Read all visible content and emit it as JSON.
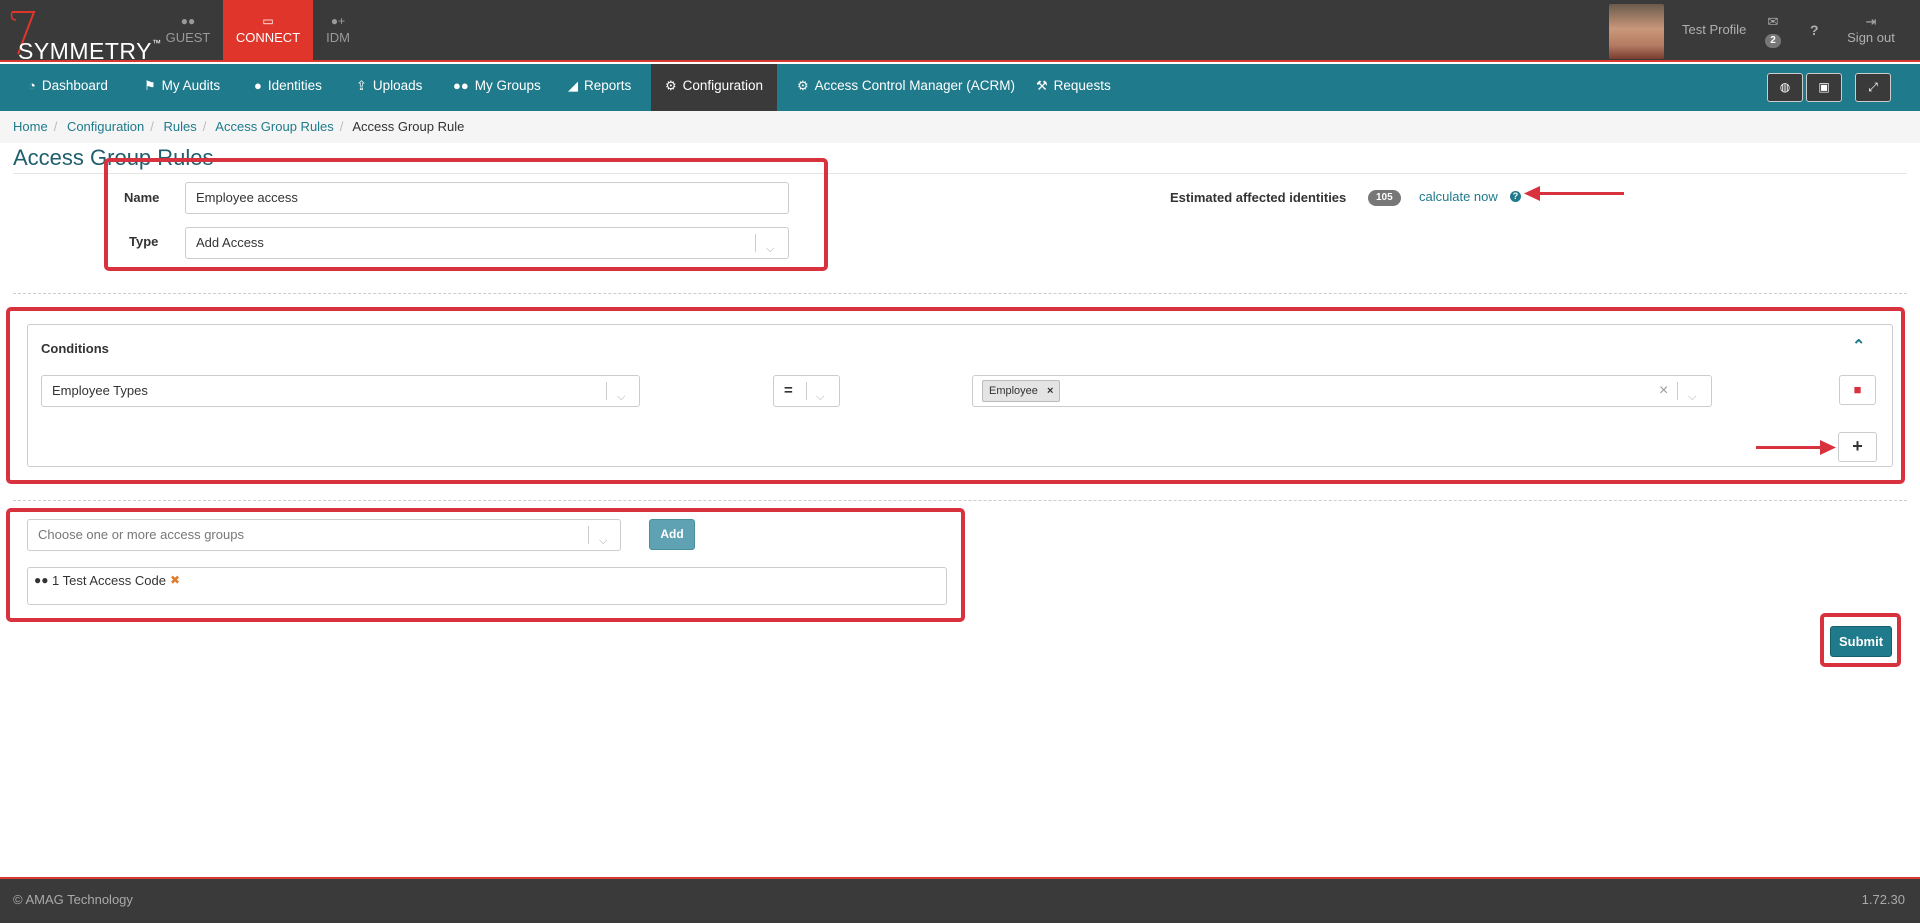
{
  "topbar": {
    "logo_text": "SYMMETRY",
    "logo_tm": "™",
    "apps": [
      {
        "label": "GUEST",
        "icon": "users-icon"
      },
      {
        "label": "CONNECT",
        "icon": "card-icon"
      },
      {
        "label": "IDM",
        "icon": "user-plus-icon"
      }
    ],
    "profile_name": "Test Profile",
    "mail_count": "2",
    "help_label": "?",
    "signout_label": "Sign out"
  },
  "nav": {
    "items": [
      {
        "label": "Dashboard",
        "icon": "dashboard-icon"
      },
      {
        "label": "My Audits",
        "icon": "flag-icon"
      },
      {
        "label": "Identities",
        "icon": "user-icon"
      },
      {
        "label": "Uploads",
        "icon": "upload-icon"
      },
      {
        "label": "My Groups",
        "icon": "group-icon"
      },
      {
        "label": "Reports",
        "icon": "area-chart-icon"
      },
      {
        "label": "Configuration",
        "icon": "gear-icon"
      },
      {
        "label": "Access Control Manager (ACRM)",
        "icon": "gear-icon"
      },
      {
        "label": "Requests",
        "icon": "wrench-icon"
      }
    ],
    "active": "Configuration"
  },
  "breadcrumb": [
    "Home",
    "Configuration",
    "Rules",
    "Access Group Rules",
    "Access Group Rule"
  ],
  "page_title": "Access Group Rules",
  "form": {
    "name_label": "Name",
    "name_value": "Employee access",
    "type_label": "Type",
    "type_value": "Add Access"
  },
  "estimate": {
    "label": "Estimated affected identities",
    "count": "105",
    "link": "calculate now",
    "help": "?"
  },
  "conditions": {
    "title": "Conditions",
    "field": "Employee Types",
    "operator": "=",
    "values": [
      "Employee"
    ],
    "tag_remove": "×",
    "clear": "×",
    "add_label": "+"
  },
  "access_groups": {
    "placeholder": "Choose one or more access groups",
    "add_label": "Add",
    "selected": [
      {
        "label": "1 Test Access Code",
        "remove": "✖"
      }
    ]
  },
  "submit_label": "Submit",
  "footer": {
    "copyright": "© AMAG Technology",
    "version": "1.72.30"
  },
  "colors": {
    "nav": "#1f7a8c",
    "topbar": "#3a3a3a",
    "accent_red": "#e0352b",
    "annotation": "#d9323f"
  }
}
